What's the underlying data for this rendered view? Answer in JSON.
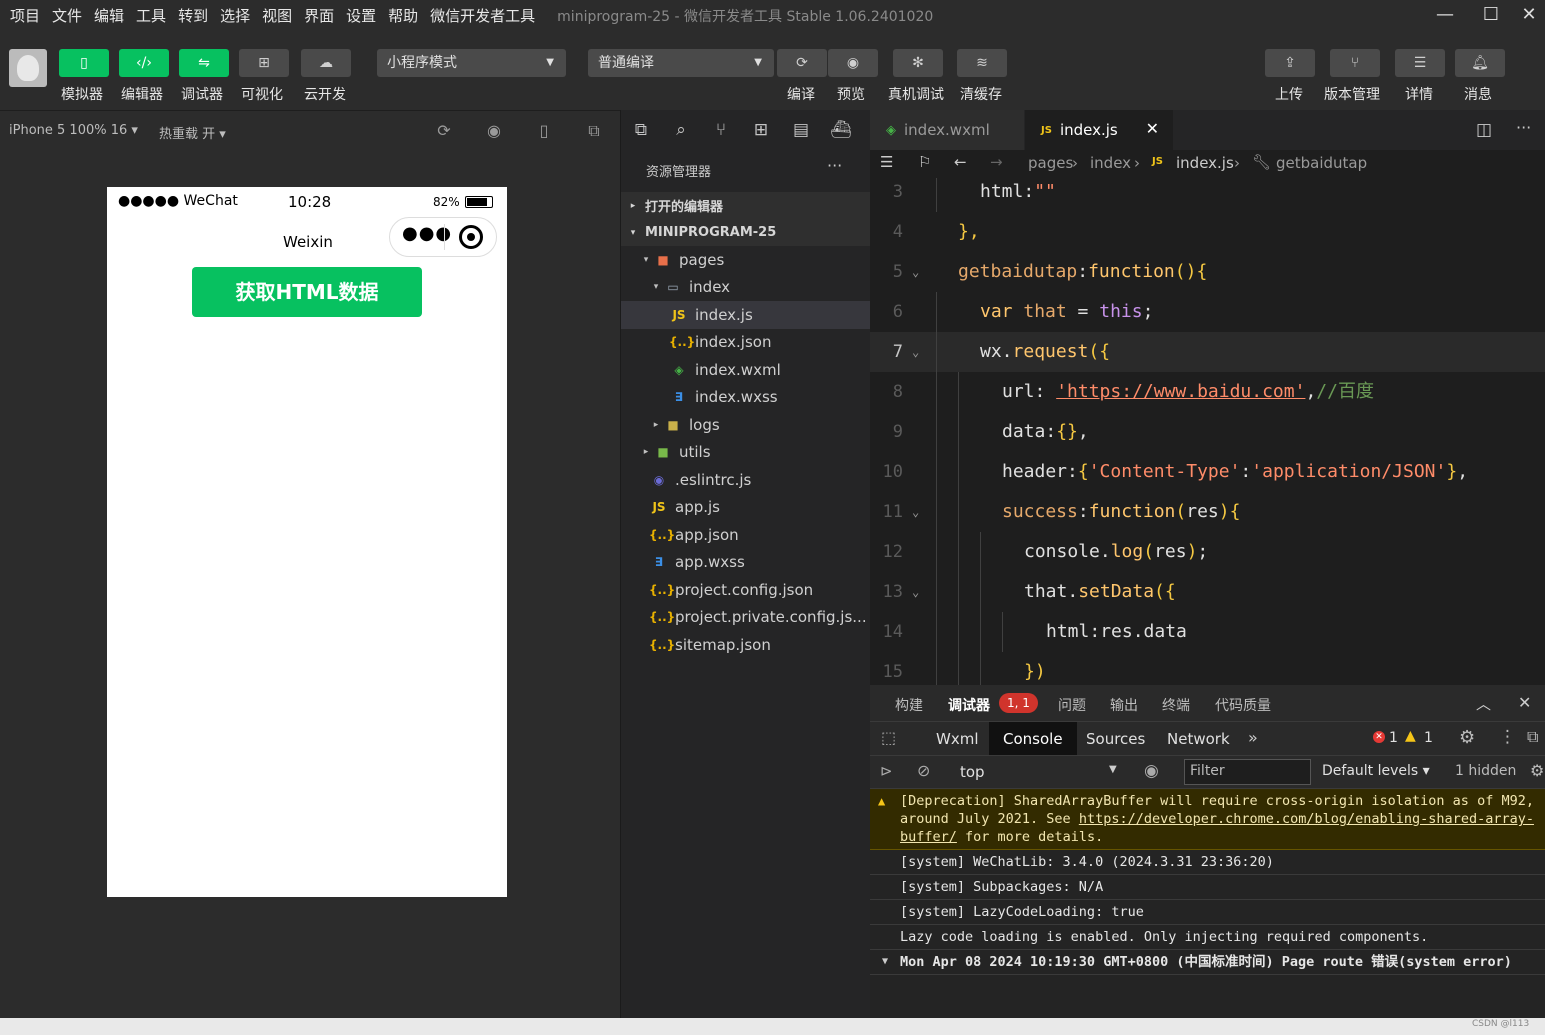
{
  "menu": [
    "项目",
    "文件",
    "编辑",
    "工具",
    "转到",
    "选择",
    "视图",
    "界面",
    "设置",
    "帮助",
    "微信开发者工具"
  ],
  "window_title": "miniprogram-25 - 微信开发者工具 Stable 1.06.2401020",
  "toolbar": {
    "left_buttons": [
      {
        "label": "模拟器",
        "icon": "phone-icon"
      },
      {
        "label": "编辑器",
        "icon": "code-icon"
      },
      {
        "label": "调试器",
        "icon": "debug-icon"
      },
      {
        "label": "可视化",
        "icon": "layout-icon"
      },
      {
        "label": "云开发",
        "icon": "cloud-icon"
      }
    ],
    "mode_select": "小程序模式",
    "compile_select": "普通编译",
    "mid_buttons": [
      {
        "label": "编译",
        "icon": "refresh-icon"
      },
      {
        "label": "预览",
        "icon": "eye-icon"
      },
      {
        "label": "真机调试",
        "icon": "bug-icon"
      },
      {
        "label": "清缓存",
        "icon": "layers-icon"
      }
    ],
    "right_buttons": [
      {
        "label": "上传",
        "icon": "upload-icon"
      },
      {
        "label": "版本管理",
        "icon": "branch-icon"
      },
      {
        "label": "详情",
        "icon": "menu-icon"
      },
      {
        "label": "消息",
        "icon": "bell-icon"
      }
    ]
  },
  "simulator": {
    "device": "iPhone 5 100% 16",
    "hot_reload": "热重载 开",
    "status_carrier": "●●●●● WeChat",
    "status_time": "10:28",
    "status_battery": "82%",
    "nav_title": "Weixin",
    "button_label": "获取HTML数据",
    "button_color": "#07c160"
  },
  "explorer": {
    "title": "资源管理器",
    "open_editors": "打开的编辑器",
    "project": "MINIPROGRAM-25",
    "tree": [
      {
        "name": "pages",
        "depth": 1,
        "arrow": "▾",
        "icon": "folder",
        "color": "#e8704a"
      },
      {
        "name": "index",
        "depth": 2,
        "arrow": "▾",
        "icon": "folder-open",
        "color": "#9aa7b5"
      },
      {
        "name": "index.js",
        "depth": 3,
        "arrow": "",
        "icon": "JS",
        "color": "#f0c419",
        "selected": true
      },
      {
        "name": "index.json",
        "depth": 3,
        "arrow": "",
        "icon": "{..}",
        "color": "#e8b100"
      },
      {
        "name": "index.wxml",
        "depth": 3,
        "arrow": "",
        "icon": "◈",
        "color": "#46b347"
      },
      {
        "name": "index.wxss",
        "depth": 3,
        "arrow": "",
        "icon": "∃",
        "color": "#3b8fe6"
      },
      {
        "name": "logs",
        "depth": 2,
        "arrow": "▸",
        "icon": "folder",
        "color": "#c9b04a"
      },
      {
        "name": "utils",
        "depth": 1,
        "arrow": "▸",
        "icon": "folder",
        "color": "#79b94a"
      },
      {
        "name": ".eslintrc.js",
        "depth": 1,
        "arrow": "",
        "icon": "◉",
        "color": "#6b6bd6"
      },
      {
        "name": "app.js",
        "depth": 1,
        "arrow": "",
        "icon": "JS",
        "color": "#f0c419"
      },
      {
        "name": "app.json",
        "depth": 1,
        "arrow": "",
        "icon": "{..}",
        "color": "#e8b100"
      },
      {
        "name": "app.wxss",
        "depth": 1,
        "arrow": "",
        "icon": "∃",
        "color": "#3b8fe6"
      },
      {
        "name": "project.config.json",
        "depth": 1,
        "arrow": "",
        "icon": "{..}",
        "color": "#e8b100"
      },
      {
        "name": "project.private.config.js...",
        "depth": 1,
        "arrow": "",
        "icon": "{..}",
        "color": "#e8b100"
      },
      {
        "name": "sitemap.json",
        "depth": 1,
        "arrow": "",
        "icon": "{..}",
        "color": "#e8b100"
      }
    ]
  },
  "editor": {
    "tabs": [
      {
        "label": "index.wxml",
        "active": false
      },
      {
        "label": "index.js",
        "active": true
      }
    ],
    "breadcrumb": [
      "pages",
      "index",
      "index.js",
      "getbaidutap"
    ],
    "lines": [
      {
        "n": "3",
        "indent": 1,
        "tokens": [
          [
            "id",
            "html:"
          ],
          [
            "st",
            "\"\""
          ]
        ]
      },
      {
        "n": "4",
        "indent": 0,
        "tokens": [
          [
            "pn",
            "},"
          ]
        ]
      },
      {
        "n": "5",
        "indent": 0,
        "fold": true,
        "tokens": [
          [
            "pr",
            "getbaidutap"
          ],
          [
            "id",
            ":"
          ],
          [
            "kw",
            "function"
          ],
          [
            "pn",
            "(){"
          ]
        ]
      },
      {
        "n": "6",
        "indent": 1,
        "tokens": [
          [
            "kw",
            "var "
          ],
          [
            "pr",
            "that "
          ],
          [
            "id",
            "= "
          ],
          [
            "th",
            "this"
          ],
          [
            "id",
            ";"
          ]
        ]
      },
      {
        "n": "7",
        "indent": 1,
        "fold": true,
        "current": true,
        "tokens": [
          [
            "id",
            "wx."
          ],
          [
            "fn",
            "request"
          ],
          [
            "pn",
            "({"
          ]
        ]
      },
      {
        "n": "8",
        "indent": 2,
        "tokens": [
          [
            "id",
            "url: "
          ],
          [
            "st",
            "'https://www.baidu.com'"
          ],
          [
            "id",
            ","
          ],
          [
            "cm",
            "//百度"
          ]
        ]
      },
      {
        "n": "9",
        "indent": 2,
        "tokens": [
          [
            "id",
            "data:"
          ],
          [
            "pn",
            "{}"
          ],
          [
            "id",
            ","
          ]
        ]
      },
      {
        "n": "10",
        "indent": 2,
        "tokens": [
          [
            "id",
            "header:"
          ],
          [
            "pn",
            "{"
          ],
          [
            "st",
            "'Content-Type'"
          ],
          [
            "id",
            ":"
          ],
          [
            "st",
            "'application/JSON'"
          ],
          [
            "pn",
            "}"
          ],
          [
            "id",
            ","
          ]
        ]
      },
      {
        "n": "11",
        "indent": 2,
        "fold": true,
        "tokens": [
          [
            "pr",
            "success"
          ],
          [
            "id",
            ":"
          ],
          [
            "kw",
            "function"
          ],
          [
            "pn",
            "("
          ],
          [
            "id",
            "res"
          ],
          [
            "pn",
            "){"
          ]
        ]
      },
      {
        "n": "12",
        "indent": 3,
        "tokens": [
          [
            "id",
            "console."
          ],
          [
            "fn",
            "log"
          ],
          [
            "pn",
            "("
          ],
          [
            "id",
            "res"
          ],
          [
            "pn",
            ")"
          ],
          [
            "id",
            ";"
          ]
        ]
      },
      {
        "n": "13",
        "indent": 3,
        "fold": true,
        "tokens": [
          [
            "id",
            "that."
          ],
          [
            "fn",
            "setData"
          ],
          [
            "pn",
            "({"
          ]
        ]
      },
      {
        "n": "14",
        "indent": 4,
        "tokens": [
          [
            "id",
            "html"
          ],
          [
            "id",
            ":res.data"
          ]
        ]
      },
      {
        "n": "15",
        "indent": 3,
        "tokens": [
          [
            "pn",
            "})"
          ]
        ]
      }
    ]
  },
  "bottom": {
    "tabs": [
      "构建",
      "调试器",
      "问题",
      "输出",
      "终端",
      "代码质量"
    ],
    "debugger_badge": "1, 1",
    "devtools_tabs": [
      "Wxml",
      "Console",
      "Sources",
      "Network"
    ],
    "error_count": "1",
    "warn_count": "1",
    "context": "top",
    "filter_placeholder": "Filter",
    "levels": "Default levels",
    "hidden": "1 hidden",
    "messages": [
      {
        "type": "warn",
        "text": "[Deprecation] SharedArrayBuffer will require cross-origin isolation as of M92, around July 2021. See ",
        "link": "https://developer.chrome.com/blog/enabling-shared-array-buffer/",
        "after": " for more details."
      },
      {
        "type": "log",
        "text": "[system] WeChatLib: 3.4.0 (2024.3.31 23:36:20)"
      },
      {
        "type": "log",
        "text": "[system] Subpackages: N/A"
      },
      {
        "type": "log",
        "text": "[system] LazyCodeLoading: true"
      },
      {
        "type": "log",
        "text": "Lazy code loading is enabled. Only injecting required components."
      },
      {
        "type": "group",
        "text": "Mon Apr 08 2024 10:19:30 GMT+0800 (中国标准时间) Page route 错误(system error)"
      }
    ]
  },
  "watermark": "CSDN @l113"
}
